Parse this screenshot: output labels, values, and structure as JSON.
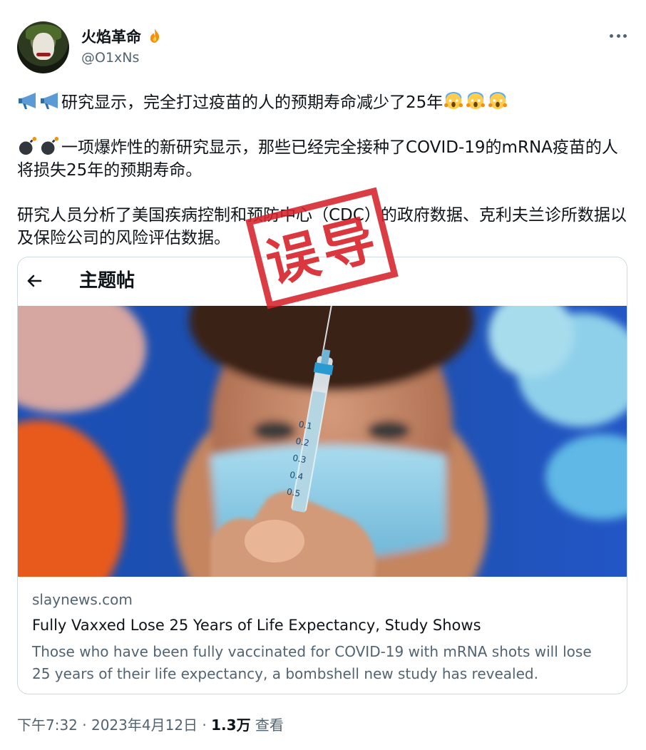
{
  "author": {
    "display_name": "火焰革命",
    "name_emoji": "fire-icon",
    "handle": "@O1xNs",
    "avatar": "avatar-image"
  },
  "tweet": {
    "line1": "研究显示，完全打过疫苗的人的预期寿命减少了25年",
    "line1_prefix_icons": [
      "megaphone-icon",
      "megaphone-icon"
    ],
    "line1_suffix_icons": [
      "scream-icon",
      "scream-icon",
      "scream-icon"
    ],
    "line2": "一项爆炸性的新研究显示，那些已经完全接种了COVID-19的mRNA疫苗的人将损失25年的预期寿命。",
    "line2_prefix_icons": [
      "bomb-icon",
      "bomb-icon"
    ],
    "line3": "研究人员分析了美国疾病控制和预防中心（CDC）的政府数据、克利夫兰诊所数据以及保险公司的风险评估数据。"
  },
  "card": {
    "topbar_title": "主题帖",
    "domain": "slaynews.com",
    "title": "Fully Vaxxed Lose 25 Years of Life Expectancy, Study Shows",
    "description": "Those who have been fully vaccinated for COVID-19 with mRNA shots will lose 25 years of their life expectancy, a bombshell new study has revealed.",
    "syringe_marks": [
      "0.1",
      "0.2",
      "0.3",
      "0.4",
      "0.5"
    ]
  },
  "footer": {
    "time": "下午7:32 · 2023年4月12日 · ",
    "views": "1.3万",
    "views_label": " 查看"
  },
  "stamp": {
    "text": "误导",
    "color": "#d6222a"
  }
}
